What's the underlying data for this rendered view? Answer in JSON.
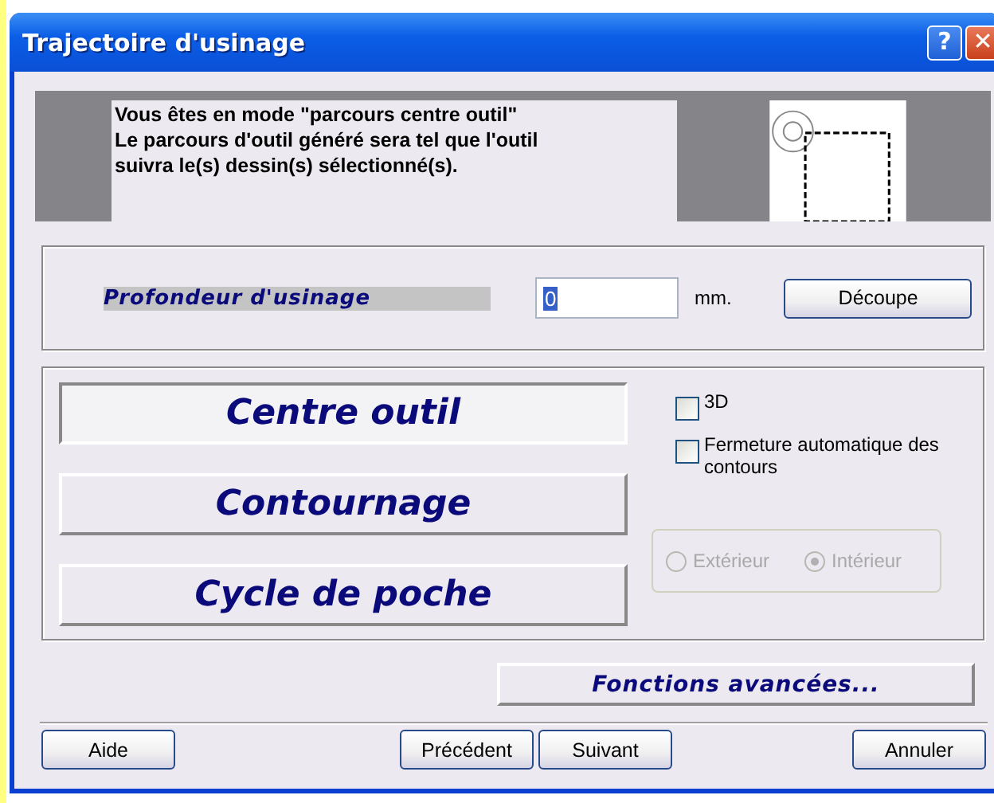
{
  "window": {
    "title": "Trajectoire d'usinage",
    "title_buttons": [
      {
        "kind": "help",
        "label": "?"
      },
      {
        "kind": "close",
        "label": "✕"
      }
    ]
  },
  "info": {
    "lines": [
      "Vous êtes en mode \"parcours centre outil\"",
      "Le parcours d'outil généré sera tel que l'outil",
      "suivra le(s) dessin(s) sélectionné(s)."
    ]
  },
  "depth": {
    "label": "Profondeur d'usinage",
    "value": "0",
    "unit": "mm.",
    "button": "Découpe"
  },
  "modes": [
    {
      "label": "Centre outil",
      "selected": true
    },
    {
      "label": "Contournage",
      "selected": false
    },
    {
      "label": "Cycle de poche",
      "selected": false
    }
  ],
  "options": [
    {
      "label": "3D",
      "checked": false
    },
    {
      "label": "Fermeture automatique des contours",
      "checked": false
    }
  ],
  "side": {
    "disabled": true,
    "radios": [
      {
        "label": "Extérieur",
        "selected": false
      },
      {
        "label": "Intérieur",
        "selected": true
      }
    ]
  },
  "advanced_button": "Fonctions avancées...",
  "buttons": [
    {
      "label": "Aide",
      "kind": "left"
    },
    {
      "label": "Précédent",
      "kind": "center"
    },
    {
      "label": "Suivant",
      "kind": "center"
    },
    {
      "label": "Annuler",
      "kind": "right"
    }
  ]
}
